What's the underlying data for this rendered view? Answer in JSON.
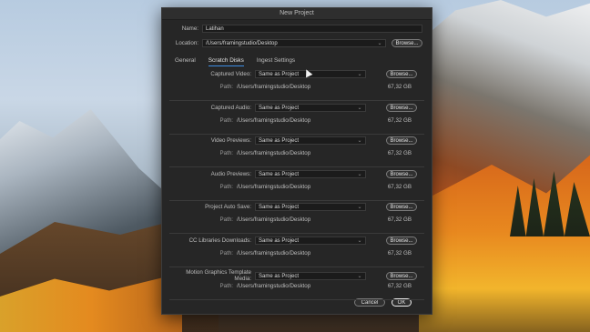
{
  "dialog": {
    "title": "New Project",
    "name_label": "Name:",
    "name_value": "Latihan",
    "location_label": "Location:",
    "location_value": "/Users/framingstudio/Desktop",
    "browse_label": "Browse...",
    "tabs": [
      "General",
      "Scratch Disks",
      "Ingest Settings"
    ],
    "active_tab_index": 1,
    "scratch_disks": [
      {
        "label": "Captured Video:",
        "value": "Same as Project",
        "path_label": "Path:",
        "path": "/Users/framingstudio/Desktop",
        "size": "67,32 GB"
      },
      {
        "label": "Captured Audio:",
        "value": "Same as Project",
        "path_label": "Path:",
        "path": "/Users/framingstudio/Desktop",
        "size": "67,32 GB"
      },
      {
        "label": "Video Previews:",
        "value": "Same as Project",
        "path_label": "Path:",
        "path": "/Users/framingstudio/Desktop",
        "size": "67,32 GB"
      },
      {
        "label": "Audio Previews:",
        "value": "Same as Project",
        "path_label": "Path:",
        "path": "/Users/framingstudio/Desktop",
        "size": "67,32 GB"
      },
      {
        "label": "Project Auto Save:",
        "value": "Same as Project",
        "path_label": "Path:",
        "path": "/Users/framingstudio/Desktop",
        "size": "67,32 GB"
      },
      {
        "label": "CC Libraries Downloads:",
        "value": "Same as Project",
        "path_label": "Path:",
        "path": "/Users/framingstudio/Desktop",
        "size": "67,32 GB"
      },
      {
        "label": "Motion Graphics Template Media:",
        "value": "Same as Project",
        "path_label": "Path:",
        "path": "/Users/framingstudio/Desktop",
        "size": "67,32 GB"
      }
    ],
    "cancel_label": "Cancel",
    "ok_label": "OK"
  },
  "colors": {
    "dialog_bg": "#262626",
    "active_tab_underline": "#3d8ee6"
  }
}
